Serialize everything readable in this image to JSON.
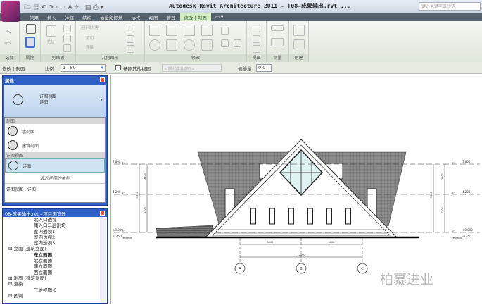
{
  "titlebar": {
    "title": "Autodesk Revit Architecture 2011 - [08-成果输出.rvt ...",
    "search_placeholder": "键入关键字或短语"
  },
  "ribbon_tabs": [
    {
      "label": "常用"
    },
    {
      "label": "插入"
    },
    {
      "label": "注释"
    },
    {
      "label": "结构"
    },
    {
      "label": "体量和场地"
    },
    {
      "label": "协作"
    },
    {
      "label": "视图"
    },
    {
      "label": "管理"
    },
    {
      "label": "修改 | 剖面",
      "active": true
    },
    {
      "label": "▭ ▾"
    }
  ],
  "ribbon_panels": [
    {
      "label": "选择"
    },
    {
      "label": "属性"
    },
    {
      "label": "剪贴板"
    },
    {
      "label": "几何图形"
    },
    {
      "label": "修改"
    },
    {
      "label": "视图"
    },
    {
      "label": "测量"
    },
    {
      "label": "创建"
    }
  ],
  "ribbon_buttons": {
    "modify": "修改",
    "paste": "粘贴",
    "join": "连接端切割",
    "cut": "剪切",
    "join2": "连接"
  },
  "options_bar": {
    "context": "修改 | 剖面",
    "scale_label": "比例",
    "scale_value": "1 : 50",
    "ref_checkbox": "参照其他视图",
    "ref_value": "<新绘制视图>",
    "offset_label": "偏移量",
    "offset_value": "0.0"
  },
  "properties": {
    "title": "属性",
    "type_family": "详图视图",
    "type_name": "详图",
    "groups": [
      {
        "label": "剖面",
        "items": [
          "墙剖面",
          "建筑剖面"
        ]
      },
      {
        "label": "详图视图",
        "items": [
          "详图"
        ]
      }
    ],
    "recent_label": "最近使用的类型",
    "recent_item": "详图视图 : 详图"
  },
  "project_browser": {
    "title": "08-成果输出.rvt - 项目浏览器",
    "items": [
      {
        "label": "北入口透视",
        "level": 2
      },
      {
        "label": "南入口二层剖切",
        "level": 2
      },
      {
        "label": "室内透视1",
        "level": 2
      },
      {
        "label": "室内透视2",
        "level": 2
      },
      {
        "label": "室内透视3",
        "level": 2
      },
      {
        "label": "立面 (建筑立面)",
        "level": 1,
        "toggle": "⊟"
      },
      {
        "label": "东立面图",
        "level": 2,
        "bold": true
      },
      {
        "label": "北立面图",
        "level": 2
      },
      {
        "label": "南立面图",
        "level": 2
      },
      {
        "label": "西立面图",
        "level": 2
      },
      {
        "label": "剖面 (建筑剖面)",
        "level": 1,
        "toggle": "⊞"
      },
      {
        "label": "渲染",
        "level": 1,
        "toggle": "⊟"
      },
      {
        "label": "三维视图 0",
        "level": 2
      },
      {
        "label": "图例",
        "level": 1,
        "toggle": "⊟"
      }
    ]
  },
  "drawing": {
    "level_labels": [
      "7.800",
      "4.200",
      "±0.000",
      "-0.450"
    ],
    "level_names": [
      "F3",
      "F2",
      "F1",
      "室外地坪"
    ],
    "dims_vertical": [
      "3300",
      "4200",
      "7800"
    ],
    "dims_horizontal": [
      "6000",
      "6000",
      "12000"
    ],
    "grids": [
      "A",
      "B",
      "C"
    ]
  },
  "watermark": "柏慕进业",
  "colors": {
    "titlebar": "#cfd9e6",
    "tabs": "#55616d",
    "active_tab": "#d4ecc4",
    "properties_header": "#2d5fc7",
    "roof": "#8a8a8a"
  }
}
